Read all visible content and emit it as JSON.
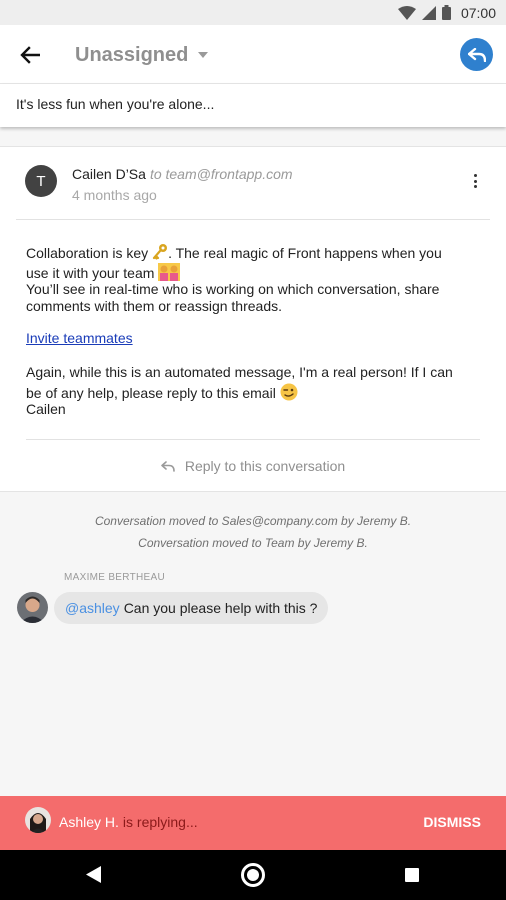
{
  "status_bar": {
    "time": "07:00",
    "icons": [
      "wifi-icon",
      "signal-icon",
      "battery-icon"
    ]
  },
  "header": {
    "back_icon": "arrow-left-icon",
    "title": "Unassigned",
    "title_caret_icon": "caret-down-icon",
    "reply_icon": "reply-icon",
    "subtitle": "It's less fun when you're alone..."
  },
  "message": {
    "avatar_initial": "T",
    "sender": "Cailen D’Sa",
    "to": "to team@frontapp.com",
    "time": "4 months ago",
    "more_icon": "more-vertical-icon",
    "body_line_1_before": "Collaboration is key",
    "body_line_1_after": ". The real magic of Front happens when you",
    "body_line_2": "use it with your team",
    "body_line_3": "You’ll see in real-time who is working on which conversation, share",
    "body_line_4": "comments with them or reassign threads.",
    "invite_link": "Invite teammates",
    "body_line_5": "Again, while this is an automated message, I'm a real person! If I can",
    "body_line_6": "be of any help, please reply to this email",
    "signature": "Cailen",
    "emojis": [
      "key-emoji",
      "team-emoji",
      "wink-emoji"
    ],
    "reply_action": "Reply to this conversation",
    "reply_action_icon": "reply-icon"
  },
  "activity": [
    "Conversation moved to Sales@company.com by Jeremy B.",
    "Conversation moved to Team by Jeremy B."
  ],
  "comment": {
    "author": "MAXIME BERTHEAU",
    "mention": "@ashley",
    "text": "Can you please help with this ?"
  },
  "typing": {
    "user": "Ashley H.",
    "status": "is replying...",
    "dismiss": "DISMISS"
  },
  "nav": {
    "icons": [
      "nav-back-icon",
      "nav-home-icon",
      "nav-recents-icon"
    ]
  },
  "colors": {
    "accent": "#2f80ce",
    "typing_bar": "#f46c6c",
    "mention": "#4a90e2",
    "link": "#1a3cb8"
  }
}
